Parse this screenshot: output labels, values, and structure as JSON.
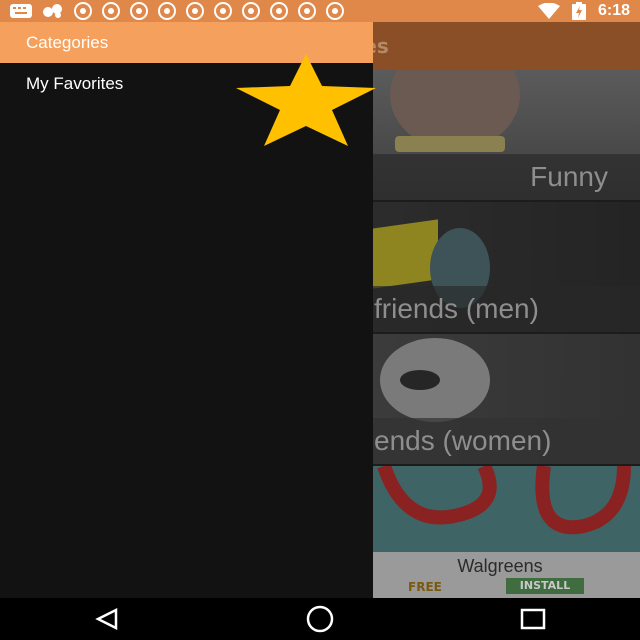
{
  "status_bar": {
    "time": "6:18",
    "notification_count": 10,
    "icons": [
      "keyboard-icon",
      "bubbles-icon",
      "soccer-ball-icon",
      "wifi-icon",
      "battery-charging-icon"
    ]
  },
  "app": {
    "toolbar_title_fragment": "otes",
    "categories": [
      {
        "label": "Funny"
      },
      {
        "label": "friends (men)"
      },
      {
        "label": "ends (women)"
      }
    ],
    "ad": {
      "title": "Walgreens",
      "free_label": "FREE",
      "install_label": "INSTALL"
    }
  },
  "drawer": {
    "header": "Categories",
    "items": [
      {
        "label": "My Favorites"
      }
    ]
  },
  "colors": {
    "status_bar": "#e0884a",
    "drawer_header": "#f5a05c",
    "drawer_bg": "#121212",
    "star": "#ffc000"
  },
  "nav_bar": {
    "icons": [
      "back-icon",
      "home-icon",
      "recents-icon"
    ]
  }
}
